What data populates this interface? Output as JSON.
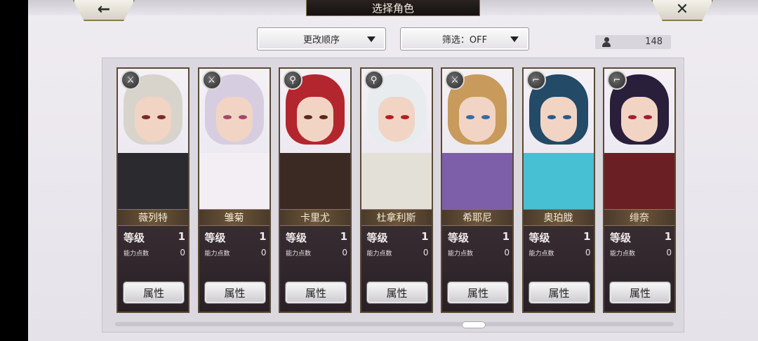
{
  "header": {
    "title": "选择角色",
    "back_glyph": "←",
    "close_glyph": "✕"
  },
  "controls": {
    "sort_label": "更改顺序",
    "filter_label": "筛选：OFF",
    "character_count": "148"
  },
  "card_labels": {
    "level": "等级",
    "ability_points": "能力点数",
    "attribute_button": "属性"
  },
  "characters": [
    {
      "name": "薇列特",
      "level": "1",
      "ability_points": "0",
      "class_icon": "sword-icon",
      "hair": "#d8d4cc",
      "eye": "#7a2a2a",
      "outfit": "#2b2b2f"
    },
    {
      "name": "雏菊",
      "level": "1",
      "ability_points": "0",
      "class_icon": "sword-icon",
      "hair": "#d7cde0",
      "eye": "#a04a6a",
      "outfit": "#f2eef4"
    },
    {
      "name": "卡里尤",
      "level": "1",
      "ability_points": "0",
      "class_icon": "staff-icon",
      "hair": "#b3262e",
      "eye": "#5a2a1a",
      "outfit": "#3b2a24"
    },
    {
      "name": "杜拿利斯",
      "level": "1",
      "ability_points": "0",
      "class_icon": "staff-icon",
      "hair": "#e8ecef",
      "eye": "#b02020",
      "outfit": "#e3e0d8"
    },
    {
      "name": "希耶尼",
      "level": "1",
      "ability_points": "0",
      "class_icon": "sword-icon",
      "hair": "#c89a5c",
      "eye": "#3a6aa0",
      "outfit": "#7c5fa8"
    },
    {
      "name": "奥珀胧",
      "level": "1",
      "ability_points": "0",
      "class_icon": "gun-icon",
      "hair": "#234a66",
      "eye": "#2a5a8a",
      "outfit": "#48c0d4"
    },
    {
      "name": "绯奈",
      "level": "1",
      "ability_points": "0",
      "class_icon": "gun-icon",
      "hair": "#2a1f3a",
      "eye": "#a02030",
      "outfit": "#6a1f24"
    }
  ]
}
